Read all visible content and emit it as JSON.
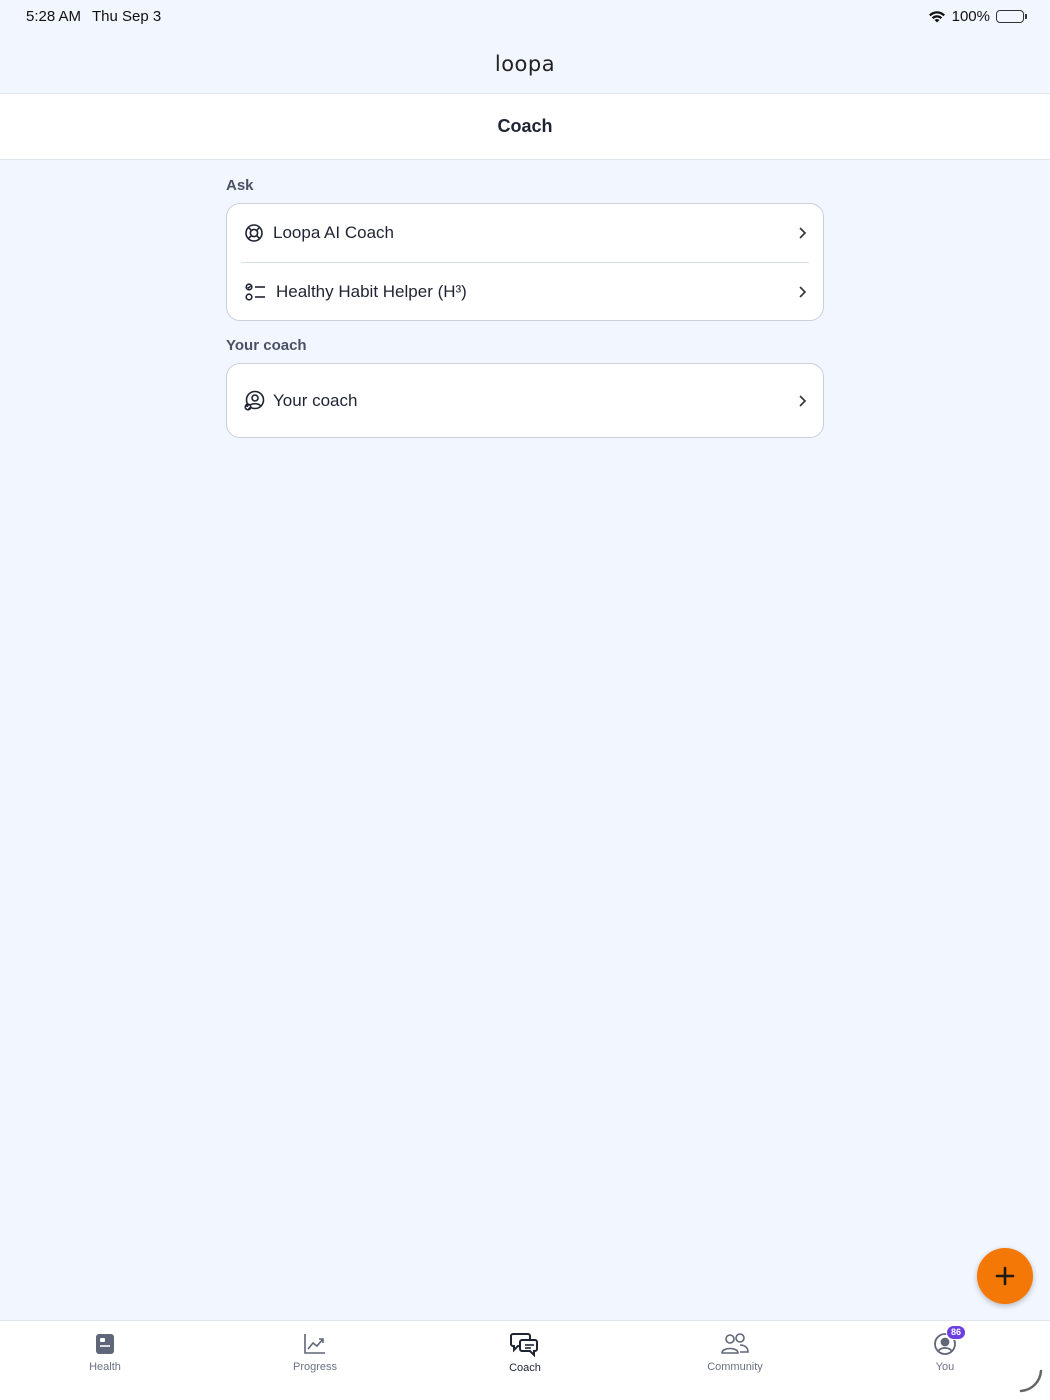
{
  "status_bar": {
    "time": "5:28 AM",
    "date": "Thu Sep 3",
    "battery_pct": "100%"
  },
  "header": {
    "logo": "loopa",
    "title": "Coach"
  },
  "sections": [
    {
      "label": "Ask",
      "items": [
        {
          "label": "Loopa AI Coach",
          "icon": "lifebuoy-icon"
        },
        {
          "label": "Healthy Habit Helper (H³)",
          "icon": "checklist-icon"
        }
      ]
    },
    {
      "label": "Your coach",
      "items": [
        {
          "label": "Your coach",
          "icon": "coach-user-icon"
        }
      ]
    }
  ],
  "fab": {
    "icon": "plus-icon",
    "color": "#f47806"
  },
  "tabs": [
    {
      "label": "Health",
      "icon": "health-icon",
      "active": false
    },
    {
      "label": "Progress",
      "icon": "chart-icon",
      "active": false
    },
    {
      "label": "Coach",
      "icon": "chat-icon",
      "active": true
    },
    {
      "label": "Community",
      "icon": "people-icon",
      "active": false
    },
    {
      "label": "You",
      "icon": "profile-icon",
      "active": false,
      "badge": "86"
    }
  ],
  "colors": {
    "background": "#f2f6fe",
    "accent": "#f47806",
    "badge": "#6b3fe0"
  }
}
